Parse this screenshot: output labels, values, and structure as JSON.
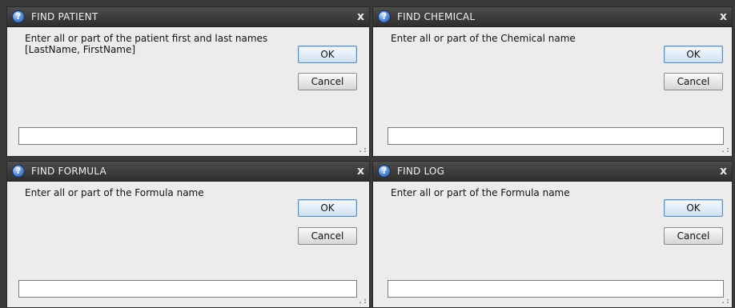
{
  "dialogs": [
    {
      "title": "FIND PATIENT",
      "prompt": "Enter all or part of the patient first and last names\n[LastName, FirstName]",
      "ok": "OK",
      "cancel": "Cancel",
      "close": "x",
      "input_value": ""
    },
    {
      "title": "FIND CHEMICAL",
      "prompt": "Enter all or part of the Chemical name",
      "ok": "OK",
      "cancel": "Cancel",
      "close": "x",
      "input_value": ""
    },
    {
      "title": "FIND FORMULA",
      "prompt": "Enter all or part of the Formula name",
      "ok": "OK",
      "cancel": "Cancel",
      "close": "x",
      "input_value": ""
    },
    {
      "title": "FIND LOG",
      "prompt": "Enter all or part of the Formula name",
      "ok": "OK",
      "cancel": "Cancel",
      "close": "x",
      "input_value": ""
    }
  ],
  "icons": {
    "title_icon": "help-question-icon",
    "close_icon": "close-icon",
    "resize_grip": "resize-grip-icon"
  },
  "colors": {
    "titlebar": "#3a3a3a",
    "dialog_body": "#ececec",
    "ok_border": "#5a8fc6"
  }
}
